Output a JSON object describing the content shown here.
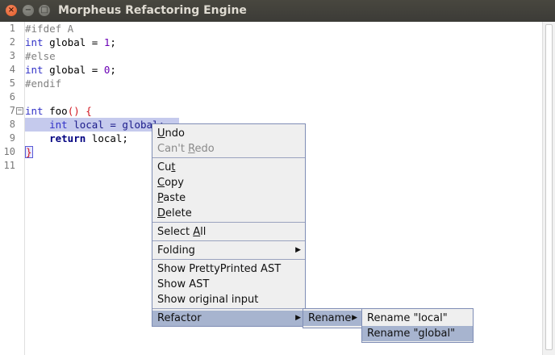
{
  "window": {
    "title": "Morpheus Refactoring Engine"
  },
  "colors": {
    "selection": "#c5caed",
    "menu_bg": "#efefef",
    "menu_active": "#a7b4cf",
    "keyword": "#3232c8"
  },
  "editor": {
    "line_numbers": [
      "1",
      "2",
      "3",
      "4",
      "5",
      "6",
      "7",
      "8",
      "9",
      "10",
      "11"
    ],
    "lines": {
      "l1": "#ifdef A",
      "l2_kw": "int",
      "l2_rest": " global = ",
      "l2_num": "1",
      "l2_end": ";",
      "l3": "#else",
      "l4_kw": "int",
      "l4_rest": " global = ",
      "l4_num": "0",
      "l4_end": ";",
      "l5": "#endif",
      "l7_kw": "int",
      "l7_name": " foo",
      "l7_paren": "()",
      "l7_brace": " {",
      "l8_indent": "    ",
      "l8_kw": "int",
      "l8_rest": " local = global;",
      "l9_indent": "    ",
      "l9_kw": "return",
      "l9_rest": " local;",
      "l10": "}"
    }
  },
  "context_menu": {
    "undo": {
      "u": "U",
      "rest": "ndo"
    },
    "redo": {
      "pre": "Can't ",
      "u": "R",
      "rest": "edo"
    },
    "cut": {
      "pre": "Cu",
      "u": "t"
    },
    "copy": {
      "u": "C",
      "rest": "opy"
    },
    "paste": {
      "u": "P",
      "rest": "aste"
    },
    "delete": {
      "u": "D",
      "rest": "elete"
    },
    "select_all": {
      "pre": "Select ",
      "u": "A",
      "rest": "ll"
    },
    "folding": "Folding",
    "show_pretty": "Show PrettyPrinted AST",
    "show_ast": "Show AST",
    "show_original": "Show original input",
    "refactor": "Refactor"
  },
  "refactor_menu": {
    "rename": "Rename"
  },
  "rename_menu": {
    "rename_local": "Rename \"local\"",
    "rename_global": "Rename \"global\""
  },
  "icons": {
    "close": "close-icon",
    "minimize": "minimize-icon",
    "maximize": "maximize-icon",
    "submenu": "submenu-arrow-icon"
  }
}
